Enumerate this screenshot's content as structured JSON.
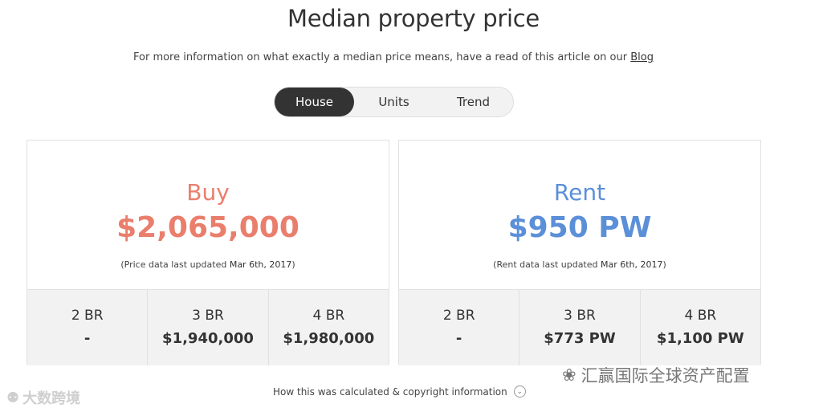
{
  "header": {
    "title": "Median property price",
    "subtitle_text": "For more information on what exactly a median price means, have a read of this article on our",
    "subtitle_link": "Blog"
  },
  "tabs": [
    {
      "label": "House",
      "active": true
    },
    {
      "label": "Units",
      "active": false
    },
    {
      "label": "Trend",
      "active": false
    }
  ],
  "buy": {
    "label": "Buy",
    "price": "$2,065,000",
    "note_prefix": "(Price data last updated",
    "note_date": "Mar 6th, 2017",
    "note_suffix": ")",
    "breakdown": [
      {
        "label": "2 BR",
        "value": "-"
      },
      {
        "label": "3 BR",
        "value": "$1,940,000"
      },
      {
        "label": "4 BR",
        "value": "$1,980,000"
      }
    ]
  },
  "rent": {
    "label": "Rent",
    "price": "$950 PW",
    "note_prefix": "(Rent data last updated",
    "note_date": "Mar 6th, 2017",
    "note_suffix": ")",
    "breakdown": [
      {
        "label": "2 BR",
        "value": "-"
      },
      {
        "label": "3 BR",
        "value": "$773 PW"
      },
      {
        "label": "4 BR",
        "value": "$1,100 PW"
      }
    ]
  },
  "footer": {
    "text": "How this was calculated & copyright information",
    "icon": "chevron-down-icon"
  },
  "watermarks": {
    "left": "大数跨境",
    "right": "汇赢国际全球资产配置"
  },
  "colors": {
    "buy": "#ea7e6c",
    "rent": "#5b8fd8",
    "active_tab": "#333333"
  }
}
